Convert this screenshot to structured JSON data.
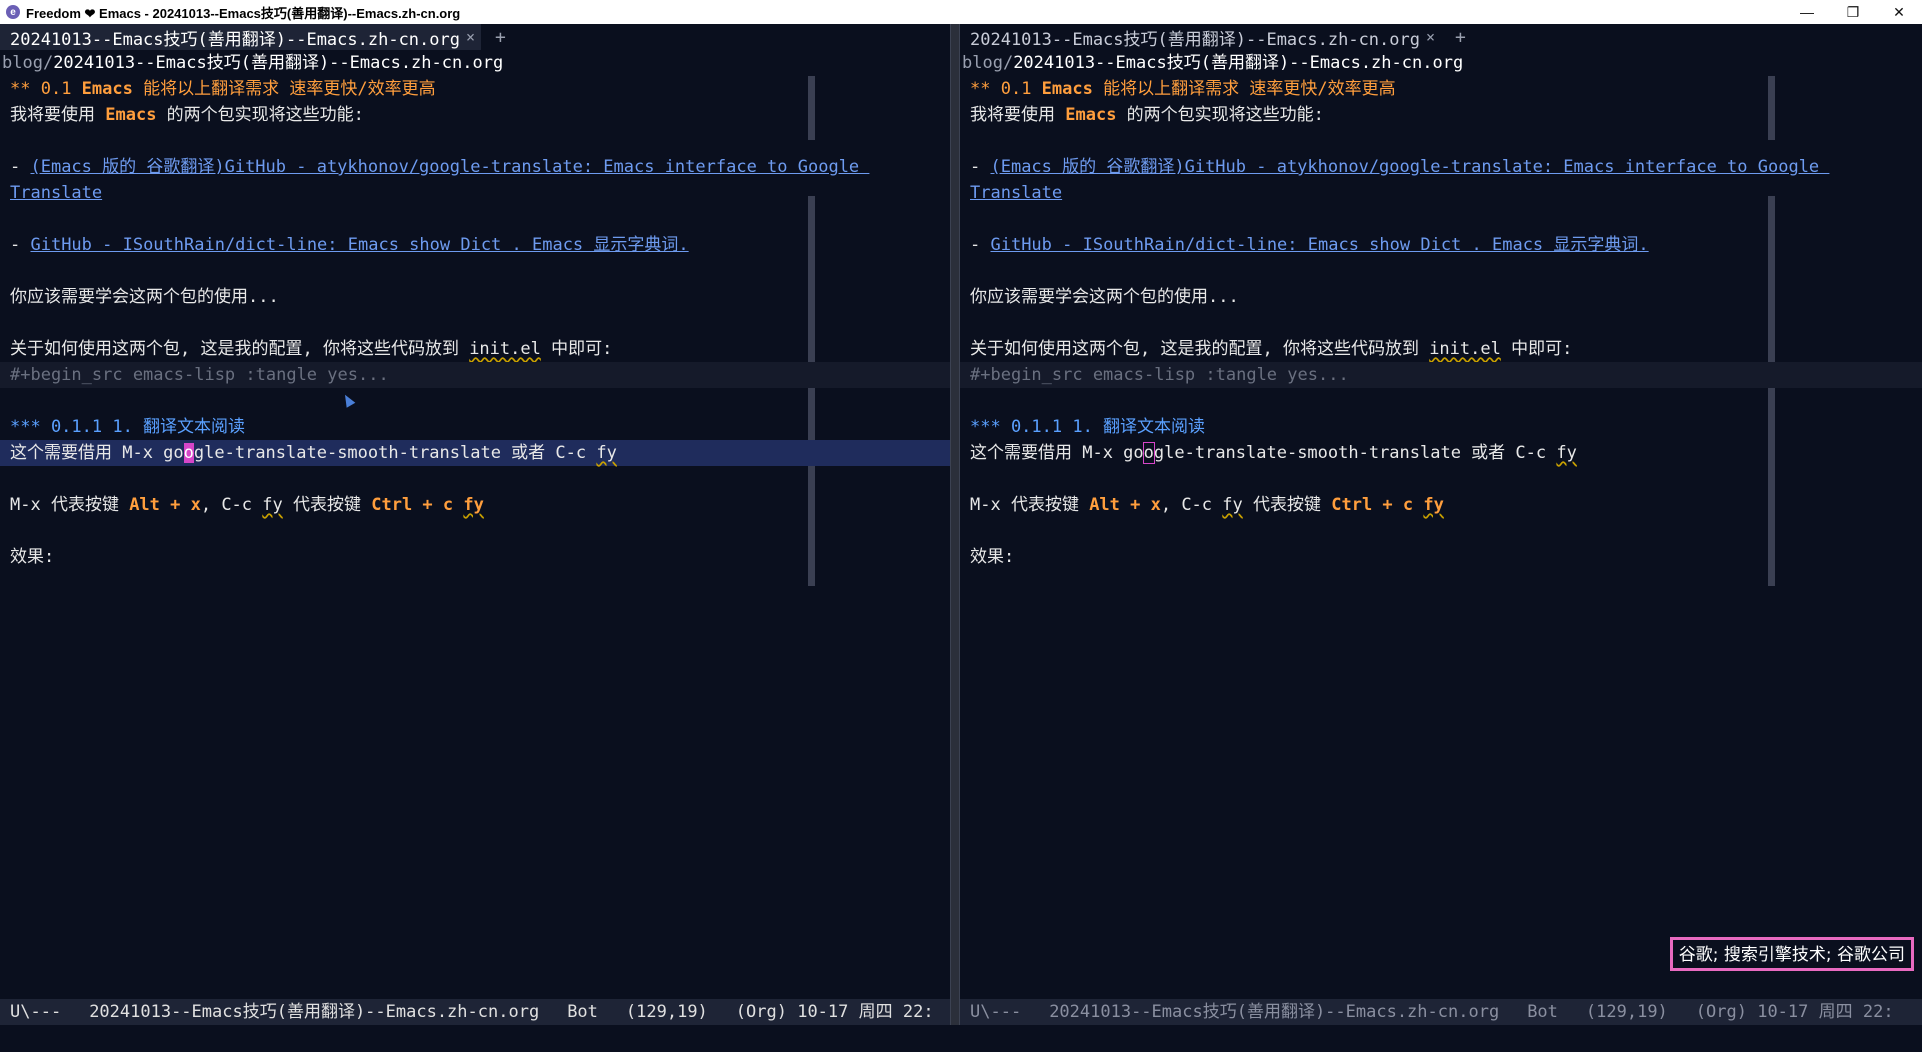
{
  "window": {
    "title": "Freedom ❤ Emacs - 20241013--Emacs技巧(善用翻译)--Emacs.zh-cn.org",
    "minimize": "—",
    "maximize": "❐",
    "close": "✕"
  },
  "tab": {
    "label": "20241013--Emacs技巧(善用翻译)--Emacs.zh-cn.org",
    "close": "×",
    "add": "+"
  },
  "header": {
    "dir": "blog/",
    "file": "20241013--Emacs技巧(善用翻译)--Emacs.zh-cn.org"
  },
  "buffer": {
    "h2_stars": "** ",
    "h2_num": "0.1 ",
    "h2_kw": "Emacs",
    "h2_rest": " 能将以上翻译需求 速率更快/效率更高",
    "p1_a": "我将要使用 ",
    "p1_kw": "Emacs",
    "p1_b": " 的两个包实现将这些功能:",
    "dash": "- ",
    "link1_a": "(Emacs 版的 谷歌翻译)GitHub - atykhonov/google-translate: Emacs interface to Google ",
    "link1_b": "Translate",
    "link2": "GitHub - ISouthRain/dict-line: Emacs show Dict . Emacs 显示字典词.",
    "p2": "你应该需要学会这两个包的使用...",
    "p3_a": "关于如何使用这两个包, 这是我的配置, 你将这些代码放到 ",
    "p3_code": "init.el",
    "p3_b": " 中即可:",
    "src_fold": "#+begin_src emacs-lisp :tangle yes...",
    "h3": "*** 0.1.1 1. 翻译文本阅读",
    "p4_a": "这个需要借用 M-x go",
    "p4_cursor": "o",
    "p4_b": "gle-translate-smooth-translate 或者 C-c ",
    "p4_fy": "fy",
    "p5_a": "M-x 代表按键 ",
    "p5_alt": "Alt + x",
    "p5_b": ", C-c ",
    "p5_fy": "fy",
    "p5_c": " 代表按键 ",
    "p5_ctrl": "Ctrl + c ",
    "p5_fy2": "fy",
    "p6": "效果:"
  },
  "modeline": {
    "state": "U\\---",
    "buffer": "20241013--Emacs技巧(善用翻译)--Emacs.zh-cn.org",
    "position": "Bot",
    "linecol": "(129,19)",
    "mode": "(Org) 10-17 周四 22:"
  },
  "popup": {
    "text": "谷歌; 搜索引擎技术; 谷歌公司"
  },
  "colors": {
    "background": "#0a0f1e",
    "heading2": "#ff9e3d",
    "heading3": "#5aa0ff",
    "link": "#6e9bf0",
    "cursor": "#d646c8",
    "popup_border": "#e86ac0"
  }
}
